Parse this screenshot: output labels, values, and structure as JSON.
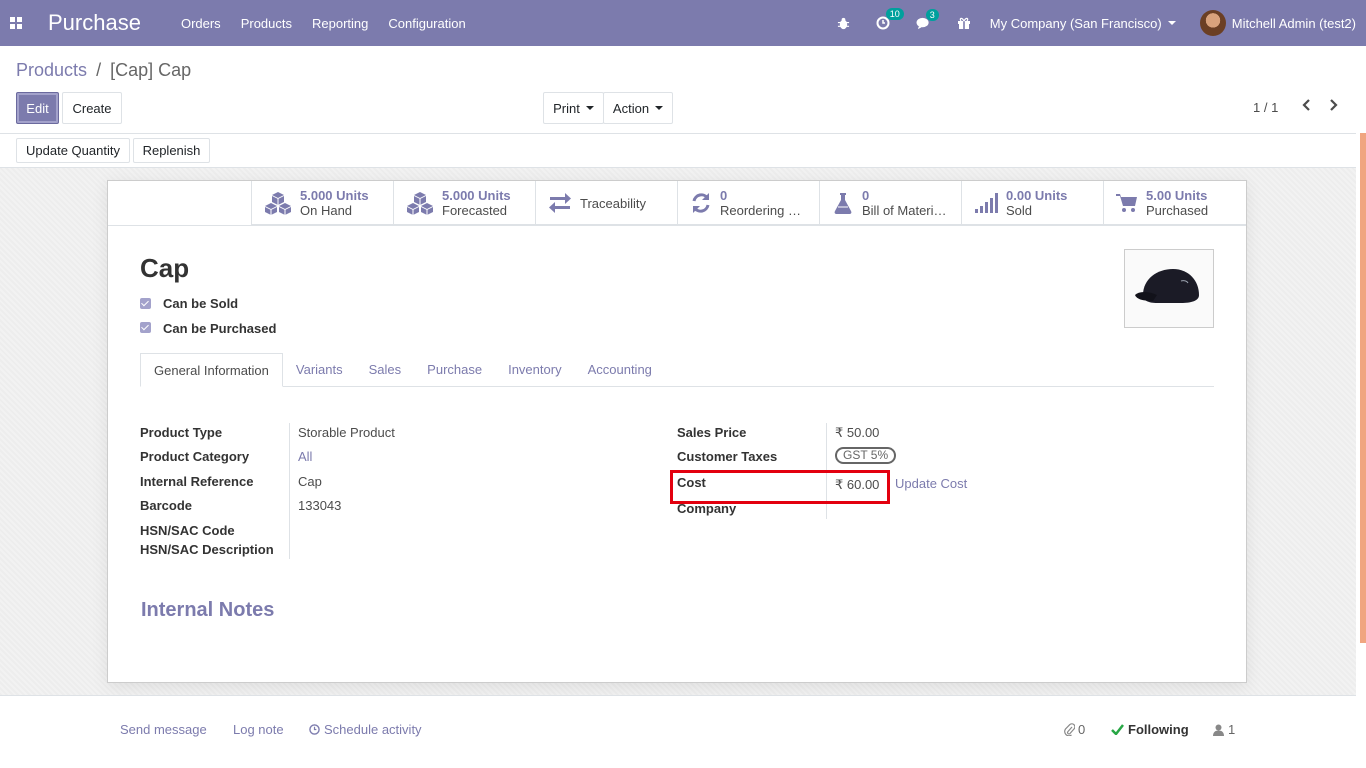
{
  "navbar": {
    "app_name": "Purchase",
    "menu": [
      "Orders",
      "Products",
      "Reporting",
      "Configuration"
    ],
    "activity_count": "10",
    "messages_count": "3",
    "company": "My Company (San Francisco)",
    "user": "Mitchell Admin (test2)"
  },
  "breadcrumb": {
    "parent": "Products",
    "separator": "/",
    "current": "[Cap] Cap"
  },
  "toolbar": {
    "edit": "Edit",
    "create": "Create",
    "print": "Print",
    "action": "Action",
    "pager": "1 / 1"
  },
  "header_buttons": {
    "update_quantity": "Update Quantity",
    "replenish": "Replenish"
  },
  "stats": {
    "on_hand": {
      "value": "5.000 Units",
      "label": "On Hand"
    },
    "forecasted": {
      "value": "5.000 Units",
      "label": "Forecasted"
    },
    "traceability": {
      "label": "Traceability"
    },
    "reordering": {
      "value": "0",
      "label": "Reordering Rules"
    },
    "bom": {
      "value": "0",
      "label": "Bill of Materials"
    },
    "sold": {
      "value": "0.00 Units",
      "label": "Sold"
    },
    "purchased": {
      "value": "5.00 Units",
      "label": "Purchased"
    }
  },
  "product": {
    "name": "Cap",
    "can_be_sold": "Can be Sold",
    "can_be_purchased": "Can be Purchased"
  },
  "tabs": [
    "General Information",
    "Variants",
    "Sales",
    "Purchase",
    "Inventory",
    "Accounting"
  ],
  "general": {
    "product_type_label": "Product Type",
    "product_type": "Storable Product",
    "product_category_label": "Product Category",
    "product_category": "All",
    "internal_ref_label": "Internal Reference",
    "internal_ref": "Cap",
    "barcode_label": "Barcode",
    "barcode": "133043",
    "hsn_code_label": "HSN/SAC Code",
    "hsn_desc_label": "HSN/SAC Description",
    "sales_price_label": "Sales Price",
    "sales_price": "₹ 50.00",
    "customer_taxes_label": "Customer Taxes",
    "customer_tax": "GST 5%",
    "cost_label": "Cost",
    "cost": "₹ 60.00",
    "update_cost": "Update Cost",
    "company_label": "Company"
  },
  "internal_notes": "Internal Notes",
  "chatter": {
    "send_message": "Send message",
    "log_note": "Log note",
    "schedule_activity": "Schedule activity",
    "attachments": "0",
    "following": "Following",
    "followers": "1"
  },
  "colors": {
    "brand": "#7c7bad",
    "highlight": "#e3000f",
    "follow": "#28a745"
  }
}
